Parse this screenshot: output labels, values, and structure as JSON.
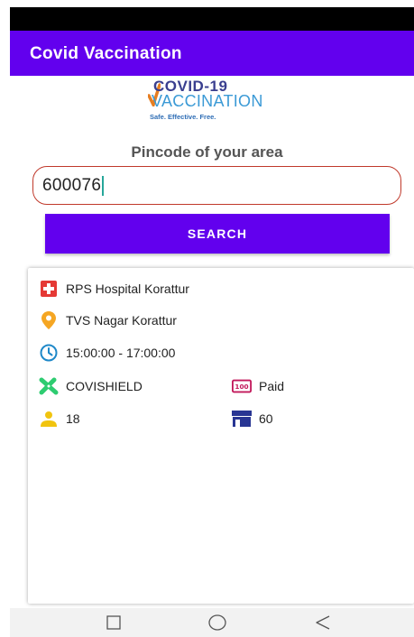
{
  "app_bar": {
    "title": "Covid Vaccination"
  },
  "logo": {
    "line1": "COVID-19",
    "line2": "VACCINATION",
    "tagline": "Safe. Effective. Free."
  },
  "search": {
    "label": "Pincode of your area",
    "value": "600076",
    "button_label": "SEARCH"
  },
  "center": {
    "name": "RPS Hospital Korattur",
    "address": "TVS Nagar Korattur",
    "time": "15:00:00 - 17:00:00",
    "vaccine": "COVISHIELD",
    "fee_type": "Paid",
    "min_age": "18",
    "capacity": "60"
  },
  "icons": {
    "hospital": "hospital-cross-icon",
    "location": "location-pin-icon",
    "clock": "clock-icon",
    "vaccine": "syringe-icon",
    "fee": "fee-badge-icon",
    "age": "person-icon",
    "capacity": "store-icon"
  },
  "colors": {
    "primary": "#6200ee",
    "input_border": "#c0392b",
    "hospital_red": "#e53935",
    "pin_amber": "#f5a623",
    "clock_blue": "#1e88c8",
    "syringe_green": "#2ecc71",
    "fee_magenta": "#c2185b",
    "person_yellow": "#f1c40f",
    "store_blue": "#283593"
  }
}
